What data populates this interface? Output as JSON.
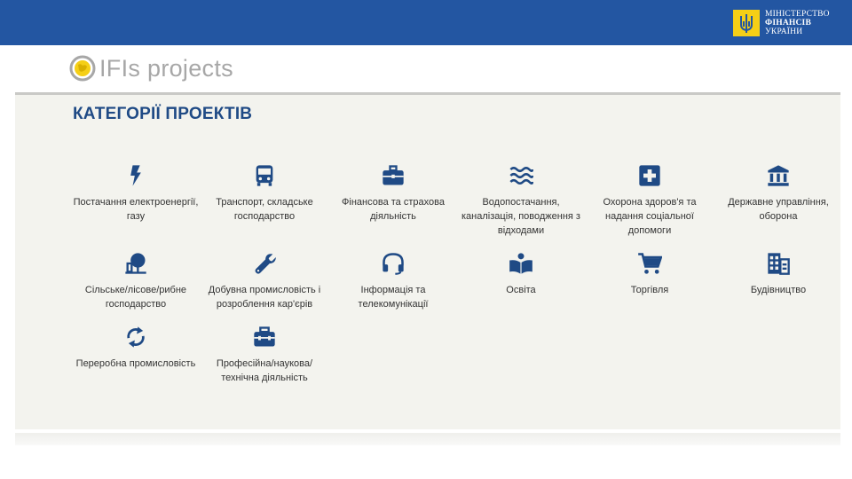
{
  "ministry": {
    "line1": "Міністерство",
    "line2": "фінансів",
    "line3": "України"
  },
  "brand": {
    "title": "IFIs projects"
  },
  "section": {
    "title": "КАТЕГОРІЇ ПРОЕКТІВ"
  },
  "colors": {
    "header_bg": "#2356a2",
    "icon_blue": "#1f4a85",
    "panel_bg": "#f3f3ee",
    "logo_yellow": "#f5cf16"
  },
  "categories": [
    {
      "label": "Постачання електроенергії, газу",
      "icon": "bolt-icon"
    },
    {
      "label": "Транспорт, складське господарство",
      "icon": "bus-icon"
    },
    {
      "label": "Фінансова та страхова діяльність",
      "icon": "briefcase-icon"
    },
    {
      "label": "Водопостачання, каналізація, поводження з відходами",
      "icon": "water-waves-icon"
    },
    {
      "label": "Охорона здоров'я та надання соціальної допомоги",
      "icon": "medical-cross-icon"
    },
    {
      "label": "Державне управління, оборона",
      "icon": "government-building-icon"
    },
    {
      "label": "Сільське/лісове/рибне господарство",
      "icon": "tree-icon"
    },
    {
      "label": "Добувна промисловість і розроблення кар'єрів",
      "icon": "wrench-icon"
    },
    {
      "label": "Інформація та телекомунікації",
      "icon": "headset-icon"
    },
    {
      "label": "Освіта",
      "icon": "open-book-icon"
    },
    {
      "label": "Торгівля",
      "icon": "shopping-cart-icon"
    },
    {
      "label": "Будівництво",
      "icon": "buildings-icon"
    },
    {
      "label": "Переробна промисловість",
      "icon": "recycle-arrows-icon"
    },
    {
      "label": "Професійна/наукова/ технічна діяльність",
      "icon": "toolbox-icon"
    }
  ]
}
